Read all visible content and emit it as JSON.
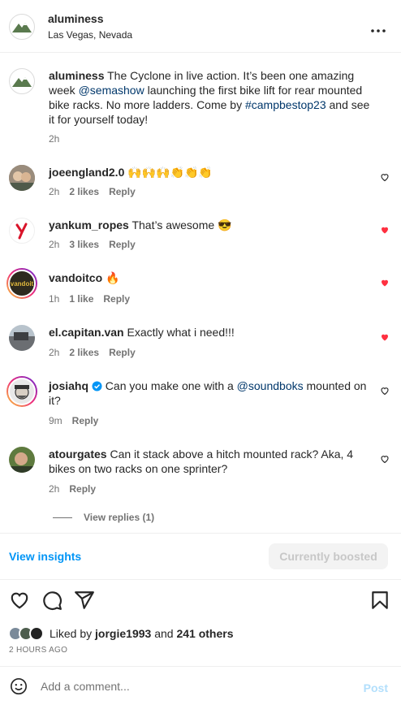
{
  "header": {
    "username": "aluminess",
    "location": "Las Vegas, Nevada",
    "more_icon": "more-horizontal-icon"
  },
  "caption": {
    "username": "aluminess",
    "text_1": " The Cyclone in live action. It’s been one amazing week ",
    "mention": "@semashow",
    "text_2": " launching the first bike lift for rear mounted bike racks. No more ladders. Come by ",
    "hashtag": "#campbestop23",
    "text_3": " and see it for yourself today!",
    "time": "2h"
  },
  "comments": [
    {
      "username": "joeengland2.0",
      "text": "🙌🙌🙌👏👏👏",
      "time": "2h",
      "likes": "2 likes",
      "reply": "Reply",
      "liked": false
    },
    {
      "username": "yankum_ropes",
      "text": "That’s awesome 😎",
      "time": "2h",
      "likes": "3 likes",
      "reply": "Reply",
      "liked": true
    },
    {
      "username": "vandoitco",
      "text": "🔥",
      "time": "1h",
      "likes": "1 like",
      "reply": "Reply",
      "liked": true
    },
    {
      "username": "el.capitan.van",
      "text": "Exactly what i need!!!",
      "time": "2h",
      "likes": "2 likes",
      "reply": "Reply",
      "liked": true
    },
    {
      "username": "josiahq",
      "text_1": "Can you make one with a ",
      "mention": "@soundboks",
      "text_2": " mounted on it?",
      "time": "9m",
      "reply": "Reply",
      "liked": false
    },
    {
      "username": "atourgates",
      "text": "Can it stack above a hitch mounted rack? Aka, 4 bikes on two racks on one sprinter?",
      "time": "2h",
      "reply": "Reply",
      "liked": false,
      "view_replies": "View replies (1)"
    }
  ],
  "avatar_labels": {
    "vandoitco": "vandoit"
  },
  "insights": {
    "view_insights": "View insights",
    "boosted": "Currently boosted"
  },
  "actions": {
    "like_icon": "heart-icon",
    "comment_icon": "comment-icon",
    "share_icon": "share-icon",
    "save_icon": "bookmark-icon"
  },
  "likes": {
    "prefix": "Liked by ",
    "user": "jorgie1993",
    "middle": " and ",
    "others": "241 others"
  },
  "timestamp": "2 HOURS AGO",
  "add_comment": {
    "placeholder": "Add a comment...",
    "post_label": "Post"
  },
  "colors": {
    "accent": "#0095f6",
    "like_red": "#ff3040",
    "link": "#00376b"
  }
}
